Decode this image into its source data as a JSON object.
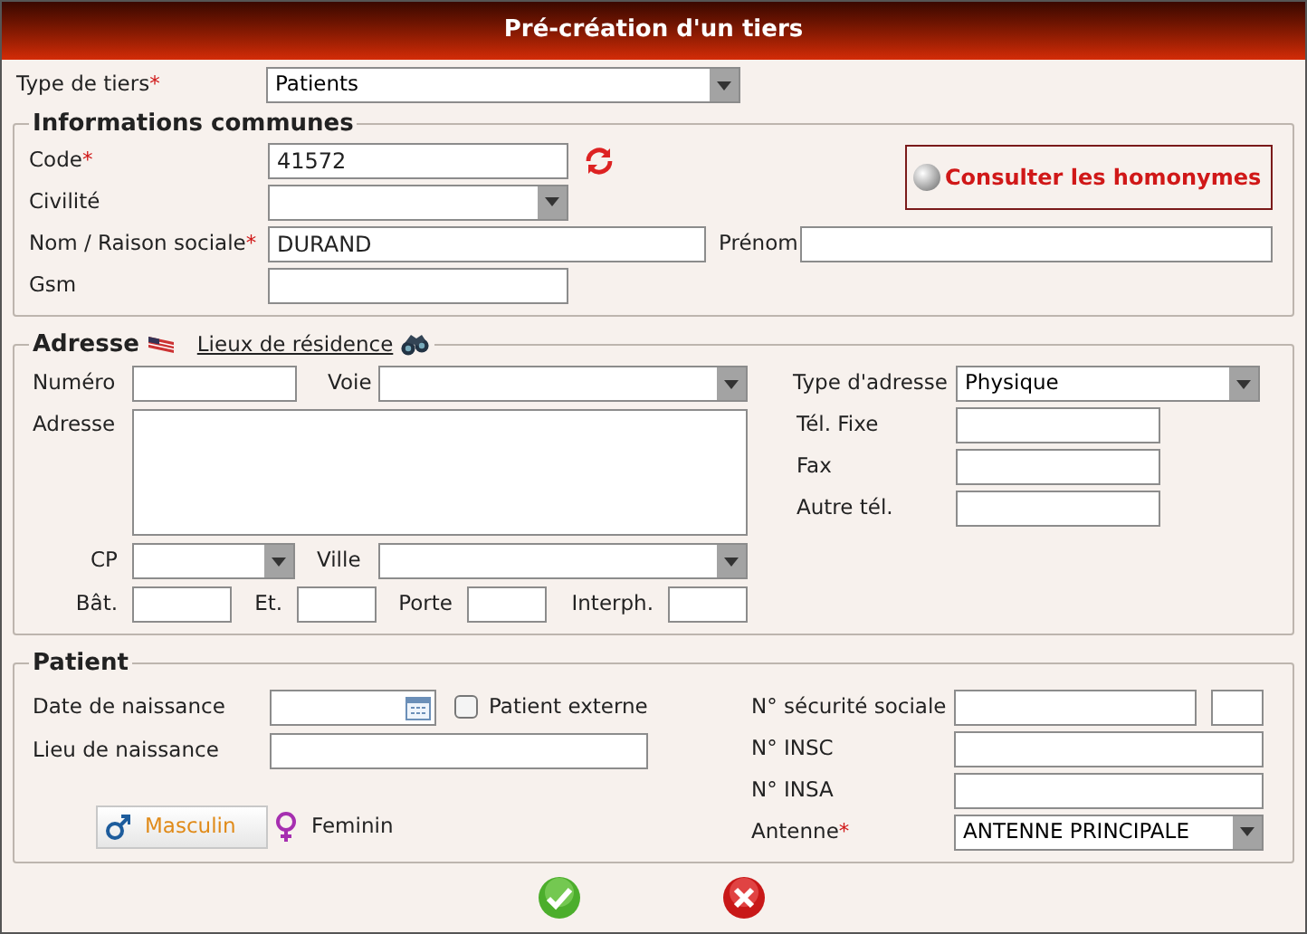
{
  "title": "Pré-création d'un tiers",
  "type_tiers": {
    "label": {
      "text": "Type de tiers",
      "mark": "*"
    },
    "value": "Patients"
  },
  "common": {
    "legend": "Informations communes",
    "code": {
      "label": {
        "text": "Code",
        "mark": "*"
      },
      "value": "41572"
    },
    "civilite": {
      "label": "Civilité"
    },
    "nom": {
      "label": {
        "text": "Nom / Raison sociale",
        "mark": "*"
      },
      "value": "DURAND"
    },
    "prenom": {
      "label": "Prénom"
    },
    "gsm": {
      "label": "Gsm"
    },
    "homonymes_button": "Consulter les homonymes"
  },
  "address": {
    "legend": "Adresse",
    "link": "Lieux de résidence",
    "numero": "Numéro",
    "voie": "Voie",
    "adresse": "Adresse",
    "cp": "CP",
    "ville": "Ville",
    "bat": "Bât.",
    "et": "Et.",
    "porte": "Porte",
    "interph": "Interph.",
    "type_adresse": {
      "label": "Type d'adresse",
      "value": "Physique"
    },
    "tel_fixe": "Tél. Fixe",
    "fax": "Fax",
    "autre_tel": "Autre tél."
  },
  "patient": {
    "legend": "Patient",
    "date_naissance": "Date de naissance",
    "patient_externe": {
      "label": "Patient externe",
      "checked": false
    },
    "lieu_naissance": "Lieu de naissance",
    "genders": [
      {
        "label": "Masculin",
        "kind": "male",
        "selected": true
      },
      {
        "label": "Feminin",
        "kind": "female",
        "selected": false
      }
    ],
    "secu": "N° sécurité sociale",
    "insc": "N° INSC",
    "insa": "N° INSA",
    "antenne": {
      "label": {
        "text": "Antenne",
        "mark": "*"
      },
      "value": "ANTENNE PRINCIPALE"
    }
  }
}
